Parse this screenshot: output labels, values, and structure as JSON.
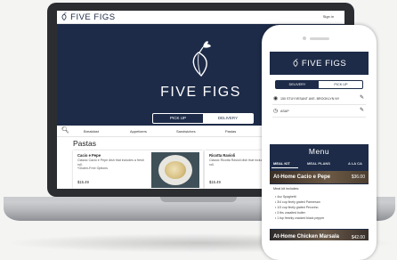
{
  "laptop_site": {
    "brand": "FIVE FIGS",
    "signin": "Sign in",
    "hero_title": "FIVE FIGS",
    "pickup": "PICK UP",
    "delivery": "DELIVERY",
    "nav": [
      "Breakfast",
      "Appetizers",
      "Sandwiches",
      "Pastas"
    ],
    "section": "Pastas",
    "cards": [
      {
        "title": "Cacio e Pepe",
        "desc": "Classic Cacio e Pepe dish that includes a fresh roll.\n*Gluten-Free Options",
        "price": "$15.49"
      },
      {
        "title": "Ricotta Ravioli",
        "desc": "Classic Ricotta Ravioli dish that includes a fresh roll.",
        "price": "$15.49"
      }
    ]
  },
  "phone_app": {
    "brand": "FIVE FIGS",
    "delivery": "DELIVERY",
    "pickup": "PICK UP",
    "address": "150 STUYVESANT AVE. BROOKLYN NY",
    "time": "ASAP",
    "menu_title": "Menu",
    "tabs": [
      "MEAL KIT",
      "MEAL PLANS",
      "A LA CA"
    ],
    "item1": {
      "name": "At-Home Cacio e Pepe",
      "price": "$36.00"
    },
    "kit_title": "Meal kit includes:",
    "kit_lines": [
      "• 4oz Spaghetti",
      "• 3/4 cup finely grated Parmesan",
      "• 1/3 cup finely grated Pecorino",
      "• 3 tbs unsalted butter",
      "• 1 tsp freshly cracked black pepper"
    ],
    "item2": {
      "name": "At-Home Chicken Marsala",
      "price": "$42.00"
    }
  },
  "colors": {
    "navy": "#1d2b48",
    "laptop_body": "#2b2d31"
  },
  "icons": [
    "fig-icon",
    "search-icon",
    "location-pin-icon",
    "clock-icon",
    "pencil-icon"
  ]
}
